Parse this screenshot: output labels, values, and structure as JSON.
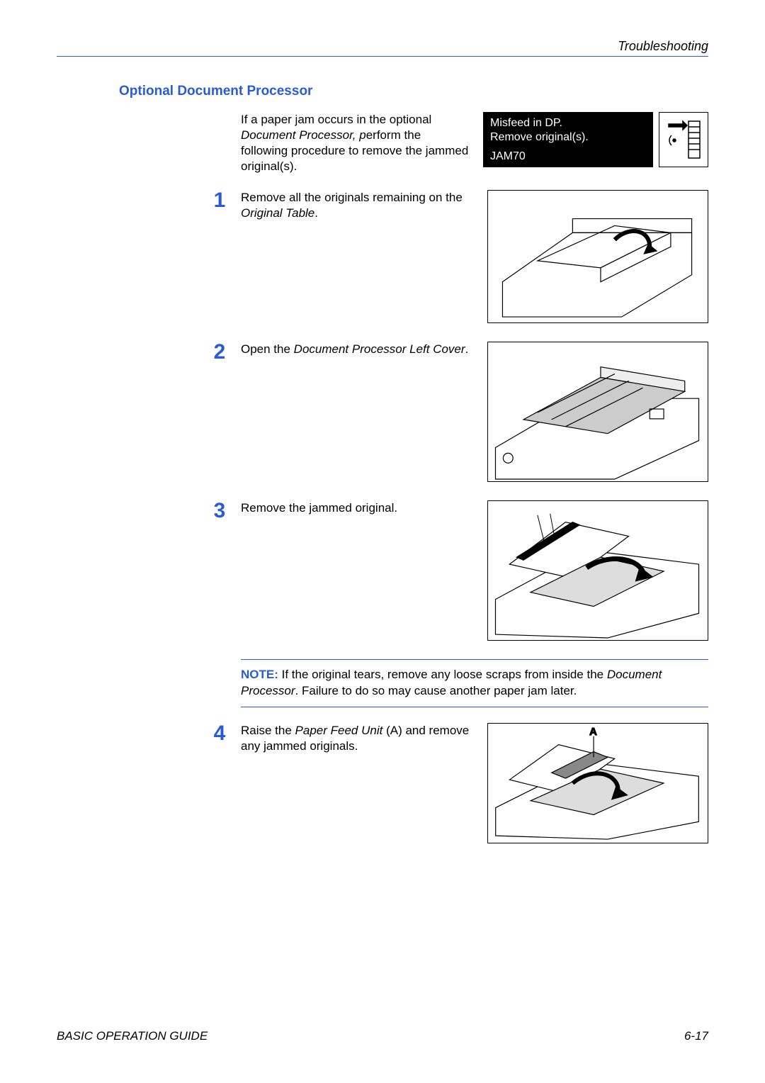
{
  "header": {
    "breadcrumb": "Troubleshooting"
  },
  "section": {
    "title": "Optional Document Processor",
    "intro": {
      "t1": "If a paper jam occurs in the optional ",
      "t2": "Document Processor, p",
      "t3": "erform the following procedure to remove the jammed original(s)."
    },
    "lcd": {
      "line1": "Misfeed in DP.",
      "line2": "Remove original(s).",
      "code": "JAM70"
    },
    "steps": [
      {
        "num": "1",
        "t1": "Remove all the originals remaining on the ",
        "t2": "Original Table",
        "t3": "."
      },
      {
        "num": "2",
        "t1": "Open the ",
        "t2": "Document Processor Left Cover",
        "t3": "."
      },
      {
        "num": "3",
        "t1": "Remove the jammed original.",
        "t2": "",
        "t3": ""
      },
      {
        "num": "4",
        "t1": "Raise the ",
        "t2": "Paper Feed Unit",
        "t3": " (A) and remove any jammed originals.",
        "label": "A"
      }
    ],
    "note": {
      "label": "NOTE:",
      "t1": " If the original tears, remove any loose scraps from inside the ",
      "t2": "Document Processor",
      "t3": ". Failure to do so may cause another paper jam later."
    }
  },
  "footer": {
    "left": "BASIC OPERATION GUIDE",
    "right": "6-17"
  }
}
